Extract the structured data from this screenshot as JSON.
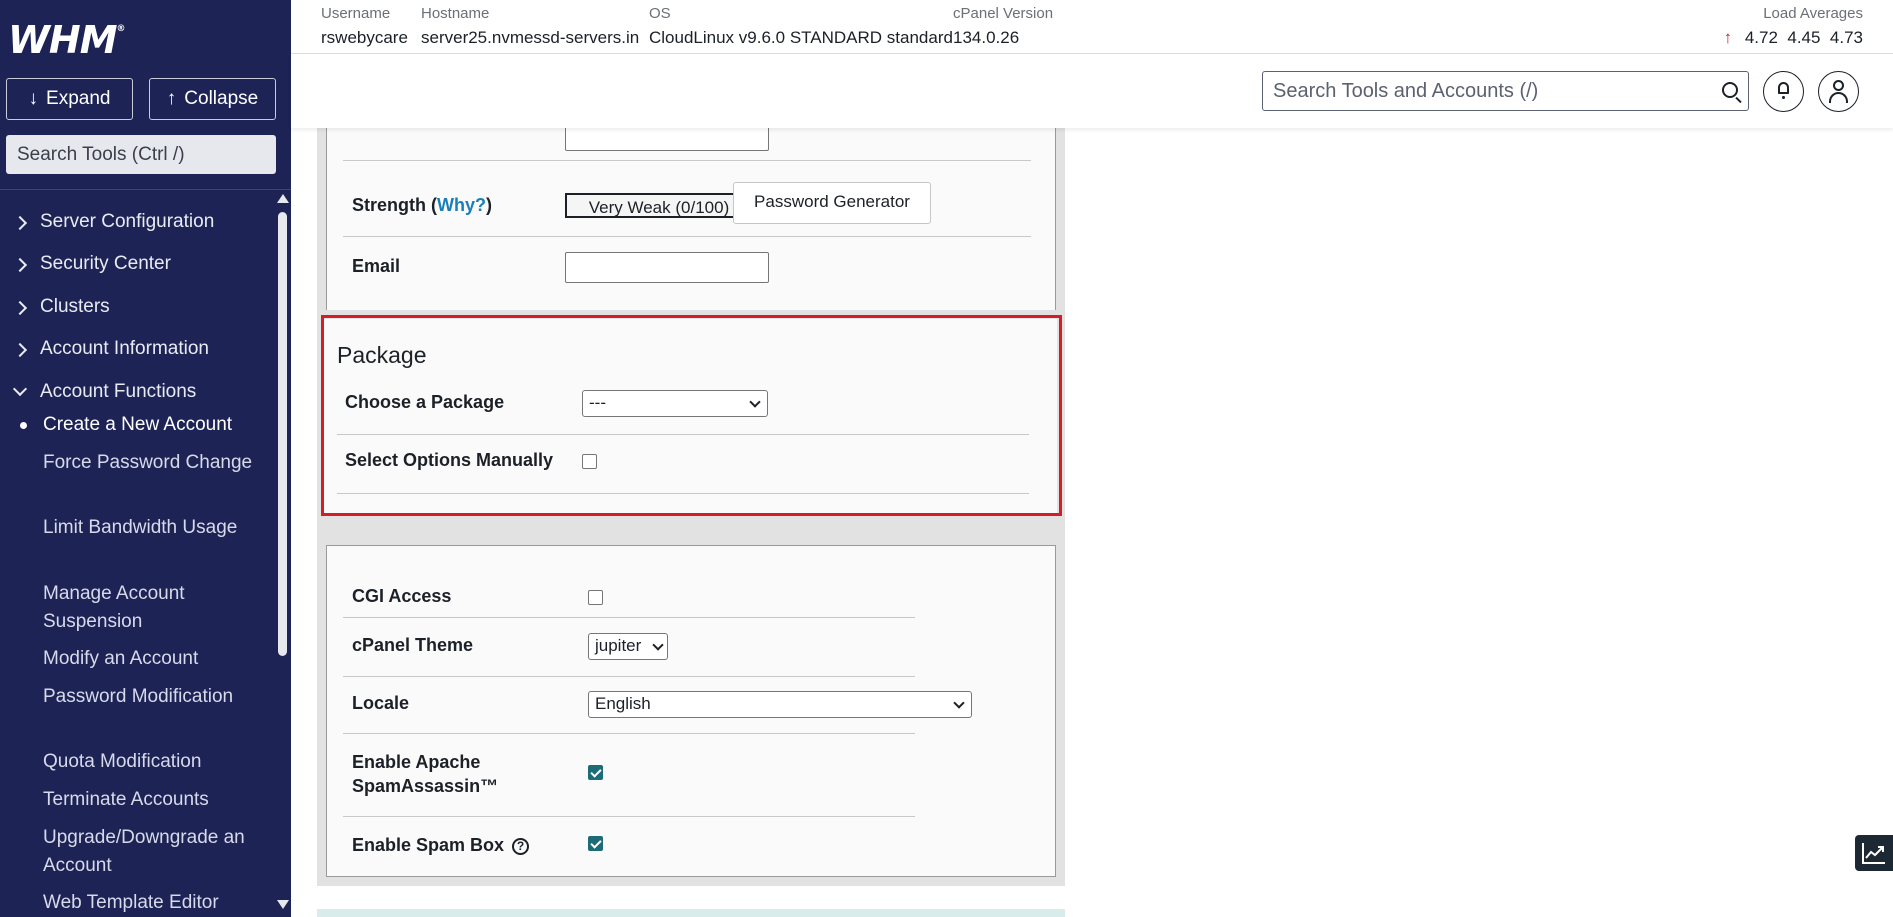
{
  "sidebar": {
    "logo": "WHM",
    "logo_mark": "®",
    "expand_label": "Expand",
    "collapse_label": "Collapse",
    "search_placeholder": "Search Tools (Ctrl /)",
    "nav": [
      {
        "label": "Server Configuration",
        "expanded": false
      },
      {
        "label": "Security Center",
        "expanded": false
      },
      {
        "label": "Clusters",
        "expanded": false
      },
      {
        "label": "Account Information",
        "expanded": false
      },
      {
        "label": "Account Functions",
        "expanded": true
      }
    ],
    "sub_items": [
      {
        "label": "Create a New Account",
        "active": true
      },
      {
        "label": "Force Password Change"
      },
      {
        "label": "Limit Bandwidth Usage"
      },
      {
        "label": "Manage Account Suspension"
      },
      {
        "label": "Modify an Account"
      },
      {
        "label": "Password Modification"
      },
      {
        "label": "Quota Modification"
      },
      {
        "label": "Terminate Accounts"
      },
      {
        "label": "Upgrade/Downgrade an Account"
      },
      {
        "label": "Web Template Editor"
      }
    ]
  },
  "header": {
    "username_key": "Username",
    "username": "rswebycare",
    "hostname_key": "Hostname",
    "hostname": "server25.nvmessd-servers.in",
    "os_key": "OS",
    "os": "CloudLinux v9.6.0 STANDARD standard",
    "cpanel_key": "cPanel Version",
    "cpanel": "134.0.26",
    "load_key": "Load Averages",
    "load_1": "4.72",
    "load_5": "4.45",
    "load_15": "4.73",
    "search_placeholder": "Search Tools and Accounts (/)"
  },
  "form": {
    "strength_label": "Strength (",
    "why_link": "Why?",
    "strength_close": ")",
    "strength_value": "Very Weak (0/100)",
    "password_generator": "Password Generator",
    "email_label": "Email",
    "email_value": "",
    "package_title": "Package",
    "choose_package_label": "Choose a Package",
    "choose_package_value": "---",
    "select_manually_label": "Select Options Manually",
    "select_manually_checked": false,
    "cgi_label": "CGI Access",
    "cgi_checked": false,
    "theme_label": "cPanel Theme",
    "theme_value": "jupiter",
    "locale_label": "Locale",
    "locale_value": "English",
    "spamassassin_label_1": "Enable Apache",
    "spamassassin_label_2": "SpamAssassin™",
    "spamassassin_checked": true,
    "spambox_label": "Enable Spam Box",
    "spambox_checked": true,
    "help_symbol": "?"
  },
  "colors": {
    "sidebar_bg": "#1d2355",
    "highlight_border": "#d41e25",
    "link": "#1a7fb8",
    "checkbox_checked": "#1d6b78",
    "load_arrow": "#c9252c"
  }
}
